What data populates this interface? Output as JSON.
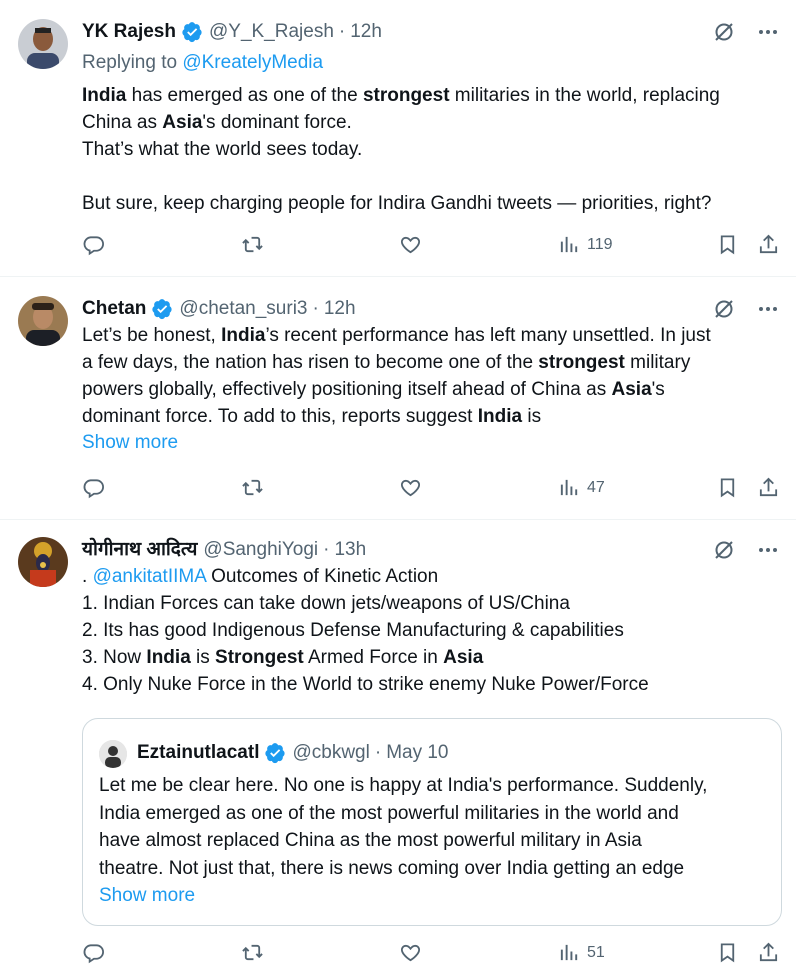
{
  "tweets": [
    {
      "name": "YK Rajesh",
      "handle": "@Y_K_Rajesh",
      "time": "12h",
      "replying_label": "Replying to",
      "replying_handle": "@KreatelyMedia",
      "body": [
        {
          "t": "India",
          "b": true
        },
        {
          "t": " has emerged as one of the "
        },
        {
          "t": "strongest",
          "b": true
        },
        {
          "t": " militaries in the world, replacing\nChina as "
        },
        {
          "t": "Asia",
          "b": true
        },
        {
          "t": "'s dominant force.\nThat’s what the world sees today.\n\nBut sure, keep charging people for Indira Gandhi tweets — priorities, right?"
        }
      ],
      "views": "119"
    },
    {
      "name": "Chetan",
      "handle": "@chetan_suri3",
      "time": "12h",
      "body": [
        {
          "t": "Let’s be honest, "
        },
        {
          "t": "India",
          "b": true
        },
        {
          "t": "’s recent performance has left many unsettled. In just\na few days, the nation has risen to become one of the "
        },
        {
          "t": "strongest",
          "b": true
        },
        {
          "t": " military\npowers globally, effectively positioning itself ahead of China as "
        },
        {
          "t": "Asia",
          "b": true
        },
        {
          "t": "'s\ndominant force. To add to this, reports suggest "
        },
        {
          "t": "India",
          "b": true
        },
        {
          "t": " is"
        }
      ],
      "show_more": "Show more",
      "views": "47"
    },
    {
      "name": "योगीनाथ आदित्य",
      "handle": "@SanghiYogi",
      "time": "13h",
      "body": [
        {
          "t": ". "
        },
        {
          "t": "@ankitatIIMA",
          "link": true
        },
        {
          "t": " Outcomes of Kinetic Action\n1. Indian Forces can take down jets/weapons of US/China\n2. Its has good Indigenous Defense Manufacturing & capabilities\n3. Now "
        },
        {
          "t": "India",
          "b": true
        },
        {
          "t": " is "
        },
        {
          "t": "Strongest",
          "b": true
        },
        {
          "t": " Armed Force in "
        },
        {
          "t": "Asia",
          "b": true
        },
        {
          "t": "\n4. Only Nuke Force in the World to strike enemy Nuke Power/Force"
        }
      ],
      "views": "51",
      "quote": {
        "name": "Eztainutlacatl",
        "handle": "@cbkwgl",
        "time": "May 10",
        "body": "Let me be clear here. No one is happy at India's performance. Suddenly,\nIndia emerged as one of the most powerful militaries in the world and\nhave almost replaced China as the most powerful military in Asia\ntheatre. Not just that, there is news coming over India getting an edge",
        "show_more": "Show more"
      }
    }
  ],
  "dot": "·",
  "colors": {
    "link": "#1d9bf0",
    "muted": "#536471",
    "border": "#eff3f4"
  }
}
